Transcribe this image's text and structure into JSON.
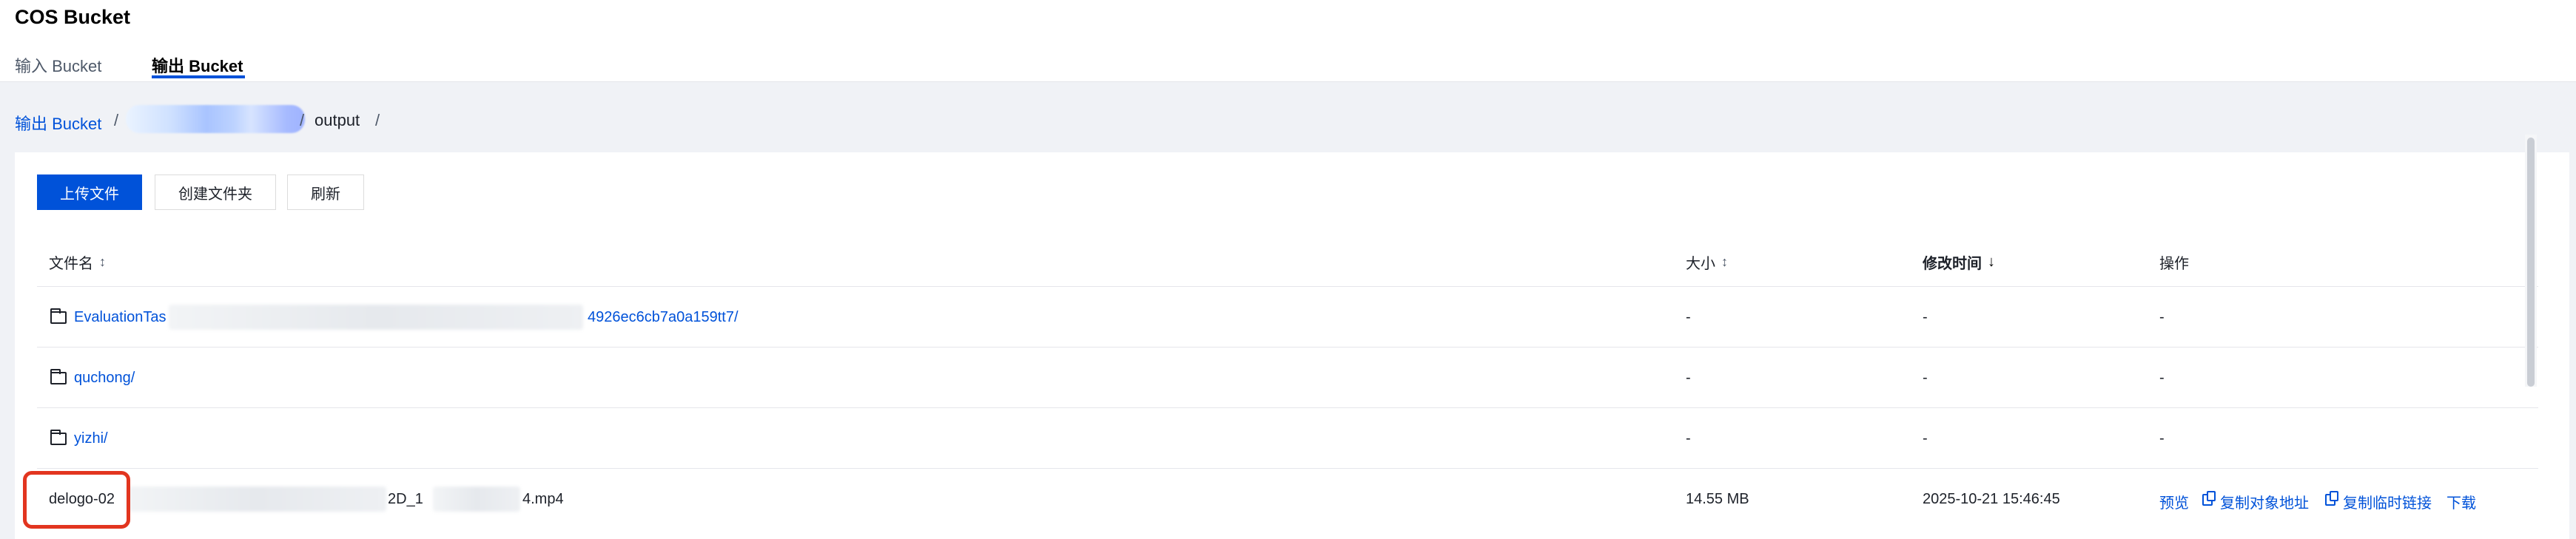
{
  "header": {
    "title": "COS Bucket",
    "tabs": [
      {
        "label": "输入 Bucket",
        "active": false
      },
      {
        "label": "输出 Bucket",
        "active": true
      }
    ]
  },
  "breadcrumb": {
    "root": "输出 Bucket",
    "separator": "/",
    "folder": "output"
  },
  "toolbar": {
    "upload": "上传文件",
    "new_folder": "创建文件夹",
    "refresh": "刷新"
  },
  "table": {
    "columns": {
      "name": "文件名",
      "size": "大小",
      "mtime": "修改时间",
      "ops": "操作"
    },
    "rows": [
      {
        "name_prefix": "EvaluationTas",
        "name_suffix": "4926ec6cb7a0a159tt7/",
        "size": "-",
        "mtime": "-",
        "ops": "-"
      },
      {
        "name": "quchong/",
        "size": "-",
        "mtime": "-",
        "ops": "-"
      },
      {
        "name": "yizhi/",
        "size": "-",
        "mtime": "-",
        "ops": "-"
      },
      {
        "name_prefix": "delogo-02",
        "name_mid": "2D_1",
        "name_suffix": "4.mp4",
        "size": "14.55 MB",
        "mtime": "2025-10-21 15:46:45",
        "ops": {
          "preview": "预览",
          "copy_url": "复制对象地址",
          "copy_temp": "复制临时链接",
          "download": "下载"
        }
      }
    ]
  },
  "colors": {
    "accent": "#0052d9",
    "highlight": "#e2351f"
  }
}
